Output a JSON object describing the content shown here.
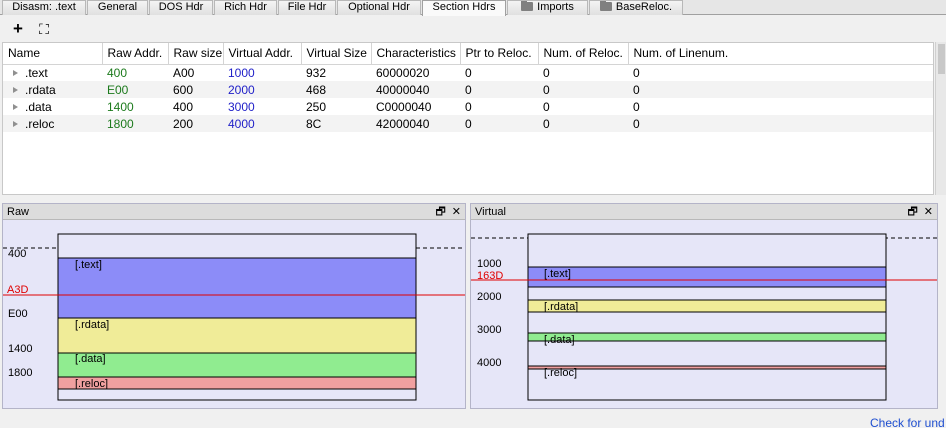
{
  "tabs": [
    {
      "label": "Disasm: .text",
      "active": false,
      "folder": false
    },
    {
      "label": "General",
      "active": false,
      "folder": false
    },
    {
      "label": "DOS Hdr",
      "active": false,
      "folder": false
    },
    {
      "label": "Rich Hdr",
      "active": false,
      "folder": false
    },
    {
      "label": "File Hdr",
      "active": false,
      "folder": false
    },
    {
      "label": "Optional Hdr",
      "active": false,
      "folder": false
    },
    {
      "label": "Section Hdrs",
      "active": true,
      "folder": false
    },
    {
      "label": "Imports",
      "active": false,
      "folder": true
    },
    {
      "label": "BaseReloc.",
      "active": false,
      "folder": true
    }
  ],
  "toolbar": {
    "add_symbol": "+",
    "collapse_symbol": "⛶"
  },
  "table": {
    "columns": [
      "Name",
      "Raw Addr.",
      "Raw size",
      "Virtual Addr.",
      "Virtual Size",
      "Characteristics",
      "Ptr to Reloc.",
      "Num. of Reloc.",
      "Num. of Linenum."
    ],
    "rows": [
      {
        "name": ".text",
        "raw_addr": "400",
        "raw_size": "A00",
        "virt_addr": "1000",
        "virt_size": "932",
        "characteristics": "60000020",
        "ptr_reloc": "0",
        "num_reloc": "0",
        "num_linenum": "0"
      },
      {
        "name": ".rdata",
        "raw_addr": "E00",
        "raw_size": "600",
        "virt_addr": "2000",
        "virt_size": "468",
        "characteristics": "40000040",
        "ptr_reloc": "0",
        "num_reloc": "0",
        "num_linenum": "0"
      },
      {
        "name": ".data",
        "raw_addr": "1400",
        "raw_size": "400",
        "virt_addr": "3000",
        "virt_size": "250",
        "characteristics": "C0000040",
        "ptr_reloc": "0",
        "num_reloc": "0",
        "num_linenum": "0"
      },
      {
        "name": ".reloc",
        "raw_addr": "1800",
        "raw_size": "200",
        "virt_addr": "4000",
        "virt_size": "8C",
        "characteristics": "42000040",
        "ptr_reloc": "0",
        "num_reloc": "0",
        "num_linenum": "0"
      }
    ]
  },
  "raw_panel": {
    "title": "Raw",
    "cursor_label": "A3D",
    "ticks": [
      "400",
      "E00",
      "1400",
      "1800"
    ],
    "sections": [
      {
        "label": "[.text]",
        "color": "#8c8cf8"
      },
      {
        "label": "[.rdata]",
        "color": "#f0ec98"
      },
      {
        "label": "[.data]",
        "color": "#90ec90"
      },
      {
        "label": "[.reloc]",
        "color": "#f0a0a0"
      }
    ]
  },
  "virtual_panel": {
    "title": "Virtual",
    "cursor_label": "163D",
    "ticks": [
      "1000",
      "2000",
      "3000",
      "4000"
    ],
    "sections": [
      {
        "label": "[.text]",
        "color": "#8c8cf8"
      },
      {
        "label": "[.rdata]",
        "color": "#f0ec98"
      },
      {
        "label": "[.data]",
        "color": "#90ec90"
      },
      {
        "label": "[.reloc]",
        "color": "#f0a0a0"
      }
    ]
  },
  "panel_buttons": {
    "float": "🗗",
    "close": "✕"
  },
  "colors": {
    "cursor": "#e00000",
    "raw_addr_text": "#1c7a1c",
    "virt_addr_text": "#1f1fc8",
    "link": "#1f4fd0"
  },
  "footer": {
    "link_text": "Check for und"
  }
}
